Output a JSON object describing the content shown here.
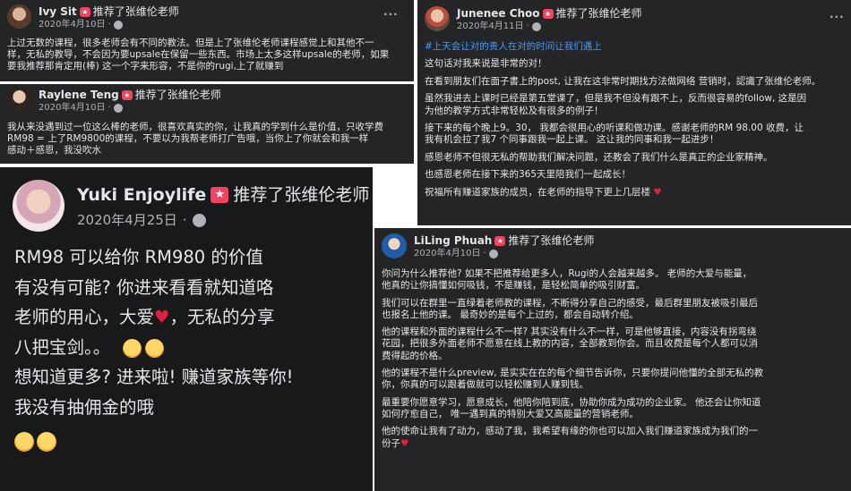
{
  "posts": {
    "ivy": {
      "author": "Ivy Sit",
      "action": "推荐了张维伦老师",
      "date": "2020年4月10日",
      "body": [
        "上过无数的课程，很多老师会有不同的教法。但是上了张维伦老师课程感觉上和其他不一",
        "样，无私的教导，不会因为要upsale在保留一些东西。市场上太多这样upsale的老师，如果",
        "要我推荐那肯定用(棒) 这一个字来形容，不是你的rugi,上了就赚到"
      ]
    },
    "raylene": {
      "author": "Raylene Teng",
      "action": "推荐了张维伦老师",
      "date": "2020年4月10日",
      "body": [
        "我从来没遇到过一位这么棒的老师，很喜欢真实的你，让我真的学到什么是价值，只收学费",
        "RM98 = 上了RM9800的课程，不要以为我帮老师打广告哦，当你上了你就会和我一样",
        "感动＋感恩，我没吹水"
      ]
    },
    "yuki": {
      "author": "Yuki Enjoylife",
      "action": "推荐了张维伦老师",
      "date": "2020年4月25日",
      "body": [
        "RM98 可以给你 RM980 的价值",
        "有没有可能? 你进来看看就知道咯",
        "老师的用心，大爱",
        "，无私的分享",
        "八把宝剑。。",
        "想知道更多? 进来啦! 赚道家族等你!",
        "我没有抽佣金的哦"
      ]
    },
    "junenee": {
      "author": "Junenee Choo",
      "action": "推荐了张维伦老师",
      "date": "2020年4月11日",
      "hashtag": "#上天会让对的贵人在对的时间让我们遇上",
      "body": [
        "这句话对我来说是非常的对！",
        "在看到朋友们在面子書上的post, 让我在这非常时期找方法做网络 营销时，認識了张维伦老师。",
        "虽然我进去上课时已经是第五堂课了，但是我不但没有跟不上，反而很容易的follow, 这是因",
        "为他的教学方式非常轻松及有很多的例子！",
        "接下来的每个晚上9。30，  我都会很用心的听课和做功课。感谢老师的RM 98.00 收费，让",
        "我有机会拉了我7 个同事跟我一起上课。 这让我的同事和我一起进步！",
        "感恩老师不但很无私的帮助我们解决问题，还教会了我们什么是真正的企业家精神。",
        "也感恩老师在接下来的365天里陪我们一起成长！",
        "祝福所有赚道家族的成员，在老师的指导下更上几层楼"
      ]
    },
    "liling": {
      "author": "LiLing Phuah",
      "action": "推荐了张维伦老师",
      "date": "2020年4月10日",
      "body": [
        "你问为什么推荐他?  如果不把推荐给更多人，Rugi的人会越来越多。 老师的大爱与能量，",
        "他真的让你搞懂如何吸钱，不是赚钱，是轻松简单的吸引财富。",
        "我们可以在群里一直绿着老师教的课程，不断得分享自己的感受，最后群里朋友被吸引最后",
        "也报名上他的课。 最奇妙的是每个上过的，都会自动转介绍。",
        "他的课程和外面的课程什么不一样?  其实没有什么不一样，可是他够直接，内容没有拐弯绕",
        "花园，把很多外面老师不愿意在线上教的内容，全部教到你会。而且收费是每个人都可以消",
        "费得起的价格。",
        "他的课程不是什么preview, 是实实在在的每个细节告诉你，只要你提问他懂的全部无私的教",
        "你，你真的可以跟着做就可以轻松赚到人赚到钱。",
        "最重要你愿意学习，愿意成长，他陪你陪到底，协助你成为成功的企业家。 他还会让你知道",
        "如何疗愈自己，  唯一遇到真的特别大爱又高能量的营销老师。",
        "他的使命让我有了动力，感动了我，我希望有缘的你也可以加入我们赚道家族成为我们的一",
        "份子"
      ]
    }
  },
  "icons": {
    "heart": "♥",
    "more": "···",
    "dot": "·"
  },
  "colors": {
    "panel_bg": "#242526",
    "text": "#e4e6eb",
    "muted": "#b0b3b8",
    "badge": "#f3425f",
    "hashtag": "#4599ff",
    "heart": "#e41e3f"
  }
}
